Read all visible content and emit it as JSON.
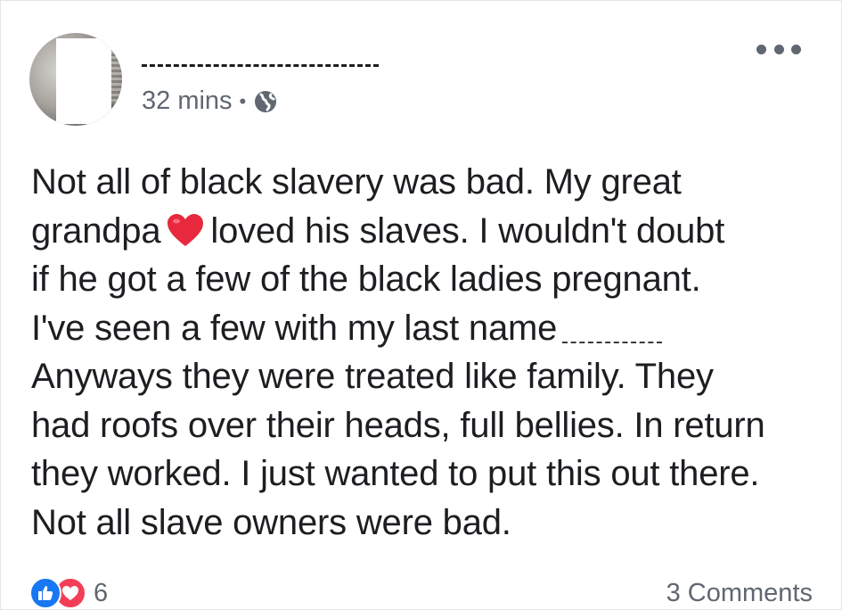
{
  "post": {
    "timestamp": "32 mins",
    "separator": "•",
    "privacy_icon": "globe-icon",
    "text_lines": [
      "Not all of black slavery was bad.  My great",
      "grandpa",
      "loved his slaves.  I wouldn't doubt",
      "if he got a few of the black ladies pregnant.",
      "I've seen a few with my last name",
      "Anyways they were treated like family.  They",
      "had roofs over their heads, full bellies.  In return",
      "they worked.  I just wanted to put this out there.",
      "Not all slave owners were bad."
    ],
    "inline_emoji": "red-heart-icon"
  },
  "footer": {
    "reaction_icons": [
      "like-icon",
      "love-icon"
    ],
    "reaction_count": "6",
    "comments_label": "3 Comments"
  },
  "colors": {
    "text": "#1c1e21",
    "secondary_text": "#606770",
    "like_blue": "#1877f2",
    "love_red": "#f33e58",
    "heart_red": "#e8283c"
  }
}
